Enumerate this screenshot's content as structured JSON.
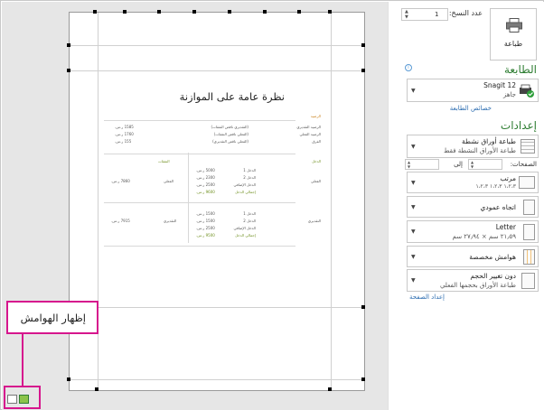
{
  "panel": {
    "copies_label": "عدد النسخ:",
    "copies_value": "1",
    "print_label": "طباعة",
    "printer_header": "الطابعة",
    "printer_name": "Snagit 12",
    "printer_status": "جاهز",
    "printer_props_link": "خصائص الطابعة",
    "settings_header": "إعدادات",
    "what_to_print": {
      "title": "طباعة أوراق نشطة",
      "subtitle": "طباعة الأوراق النشطة فقط"
    },
    "pages_label": "الصفحات:",
    "pages_to": "إلى",
    "collate": {
      "title": "مرتب",
      "subtitle": "١،٢،٣    ١،٢،٣    ١،٢،٣"
    },
    "orientation": {
      "title": "اتجاه عمودي"
    },
    "paper": {
      "title": "Letter",
      "subtitle": "٢١٫٥٩ سم × ٢٧٫٩٤ سم"
    },
    "margins": {
      "title": "هوامش مخصصة"
    },
    "scaling": {
      "title": "دون تغيير الحجم",
      "subtitle": "طباعة الأوراق بحجمها الفعلي"
    },
    "page_setup_link": "إعداد الصفحة"
  },
  "callout": {
    "text": "إظهار الهوامش"
  },
  "document": {
    "title": "نظرة عامة على الموازنة",
    "balance": {
      "label": "الرصيد",
      "rows": [
        {
          "name": "الرصيد التقديري",
          "desc": "(التقديري ناقص النفقات)",
          "value": "1585 ر.س."
        },
        {
          "name": "الرصيد الفعلي",
          "desc": "(الفعلي ناقص النفقات)",
          "value": "1760 ر.س."
        },
        {
          "name": "الفرق",
          "desc": "(الفعلي ناقص التقديري)",
          "value": "155 ر.س."
        }
      ]
    },
    "income_label": "الدخل",
    "expenses_label": "النفقات",
    "actual": {
      "name": "الفعلي",
      "income": [
        {
          "label": "الدخل 1",
          "value": "5000 ر.س."
        },
        {
          "label": "الدخل 2",
          "value": "2300 ر.س."
        },
        {
          "label": "الدخل الإضافي",
          "value": "2500 ر.س."
        }
      ],
      "total_label": "إجمالي الدخل",
      "total_value": "9600 ر.س.",
      "exp_name": "الفعلي",
      "exp_value": "7860 ر.س."
    },
    "estimated": {
      "name": "التقديري",
      "income": [
        {
          "label": "الدخل 1",
          "value": "1500 ر.س."
        },
        {
          "label": "الدخل 2",
          "value": "1500 ر.س."
        },
        {
          "label": "الدخل الإضافي",
          "value": "2500 ر.س."
        }
      ],
      "total_label": "إجمالي الدخل",
      "total_value": "9500 ر.س.",
      "exp_name": "التقديري",
      "exp_value": "7915 ر.س."
    }
  },
  "colors": {
    "accent_green": "#2e7d32",
    "link_blue": "#2b6cb0",
    "callout_magenta": "#d6168d"
  }
}
